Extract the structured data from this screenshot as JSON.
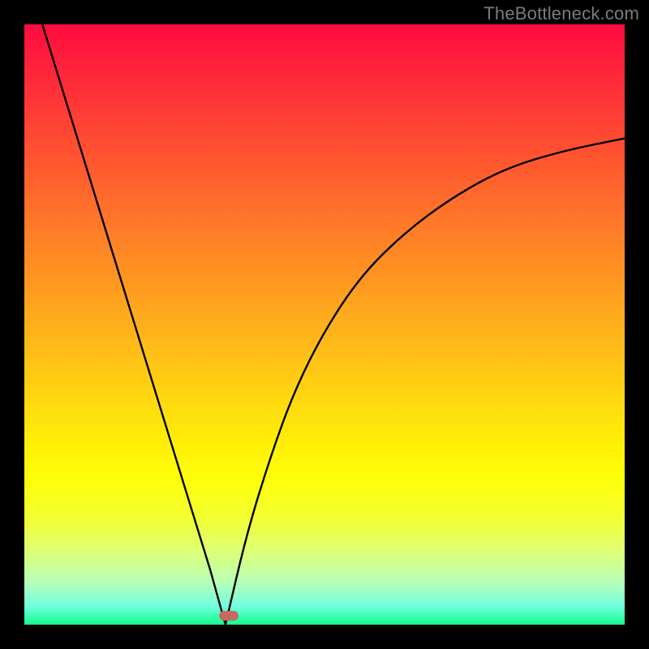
{
  "watermark": "TheBottleneck.com",
  "colors": {
    "bg": "#000000",
    "curve_stroke": "#000000",
    "marker": "#c56a62"
  },
  "chart_data": {
    "type": "line",
    "title": "",
    "xlabel": "",
    "ylabel": "",
    "xlim": [
      0,
      1
    ],
    "ylim": [
      0,
      1
    ],
    "x_min_frac": 0.335,
    "marker": {
      "x_frac": 0.34,
      "y_frac": 0.985
    },
    "series": [
      {
        "name": "left-branch",
        "x": [
          0.03,
          0.07,
          0.11,
          0.15,
          0.19,
          0.23,
          0.27,
          0.31,
          0.335
        ],
        "y": [
          1.0,
          0.87,
          0.74,
          0.61,
          0.48,
          0.35,
          0.22,
          0.09,
          0.0
        ]
      },
      {
        "name": "right-branch",
        "x": [
          0.335,
          0.37,
          0.41,
          0.45,
          0.5,
          0.56,
          0.63,
          0.71,
          0.8,
          0.9,
          1.0
        ],
        "y": [
          0.0,
          0.15,
          0.28,
          0.39,
          0.49,
          0.58,
          0.65,
          0.71,
          0.76,
          0.79,
          0.81
        ]
      }
    ]
  }
}
